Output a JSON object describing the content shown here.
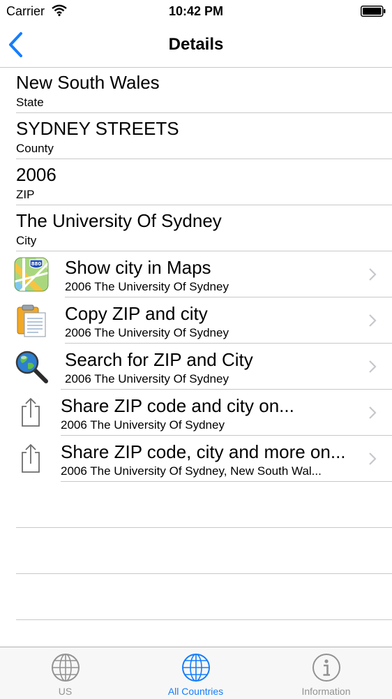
{
  "status_bar": {
    "carrier": "Carrier",
    "time": "10:42 PM"
  },
  "nav": {
    "title": "Details",
    "back_icon": "chevron-left-icon"
  },
  "details": [
    {
      "value": "New South Wales",
      "label": "State"
    },
    {
      "value": "SYDNEY STREETS",
      "label": "County"
    },
    {
      "value": "2006",
      "label": "ZIP"
    },
    {
      "value": "The University Of Sydney",
      "label": "City"
    }
  ],
  "actions": [
    {
      "title": "Show city in Maps",
      "subtitle": "2006 The University Of Sydney",
      "icon": "maps-icon",
      "map_badge": "880"
    },
    {
      "title": "Copy ZIP and city",
      "subtitle": "2006 The University Of Sydney",
      "icon": "clipboard-icon"
    },
    {
      "title": "Search for ZIP and City",
      "subtitle": "2006 The University Of Sydney",
      "icon": "globe-search-icon"
    },
    {
      "title": "Share ZIP code and city on...",
      "subtitle": "2006 The University Of Sydney",
      "icon": "share-icon"
    },
    {
      "title": "Share ZIP code, city and more on...",
      "subtitle": "2006 The University Of Sydney, New South Wal...",
      "icon": "share-icon"
    }
  ],
  "tabs": [
    {
      "label": "US",
      "icon": "globe-icon",
      "active": false
    },
    {
      "label": "All Countries",
      "icon": "globe-icon",
      "active": true
    },
    {
      "label": "Information",
      "icon": "info-icon",
      "active": false
    }
  ],
  "colors": {
    "accent": "#157efb",
    "inactive": "#929292",
    "separator": "#c8c7cc"
  }
}
